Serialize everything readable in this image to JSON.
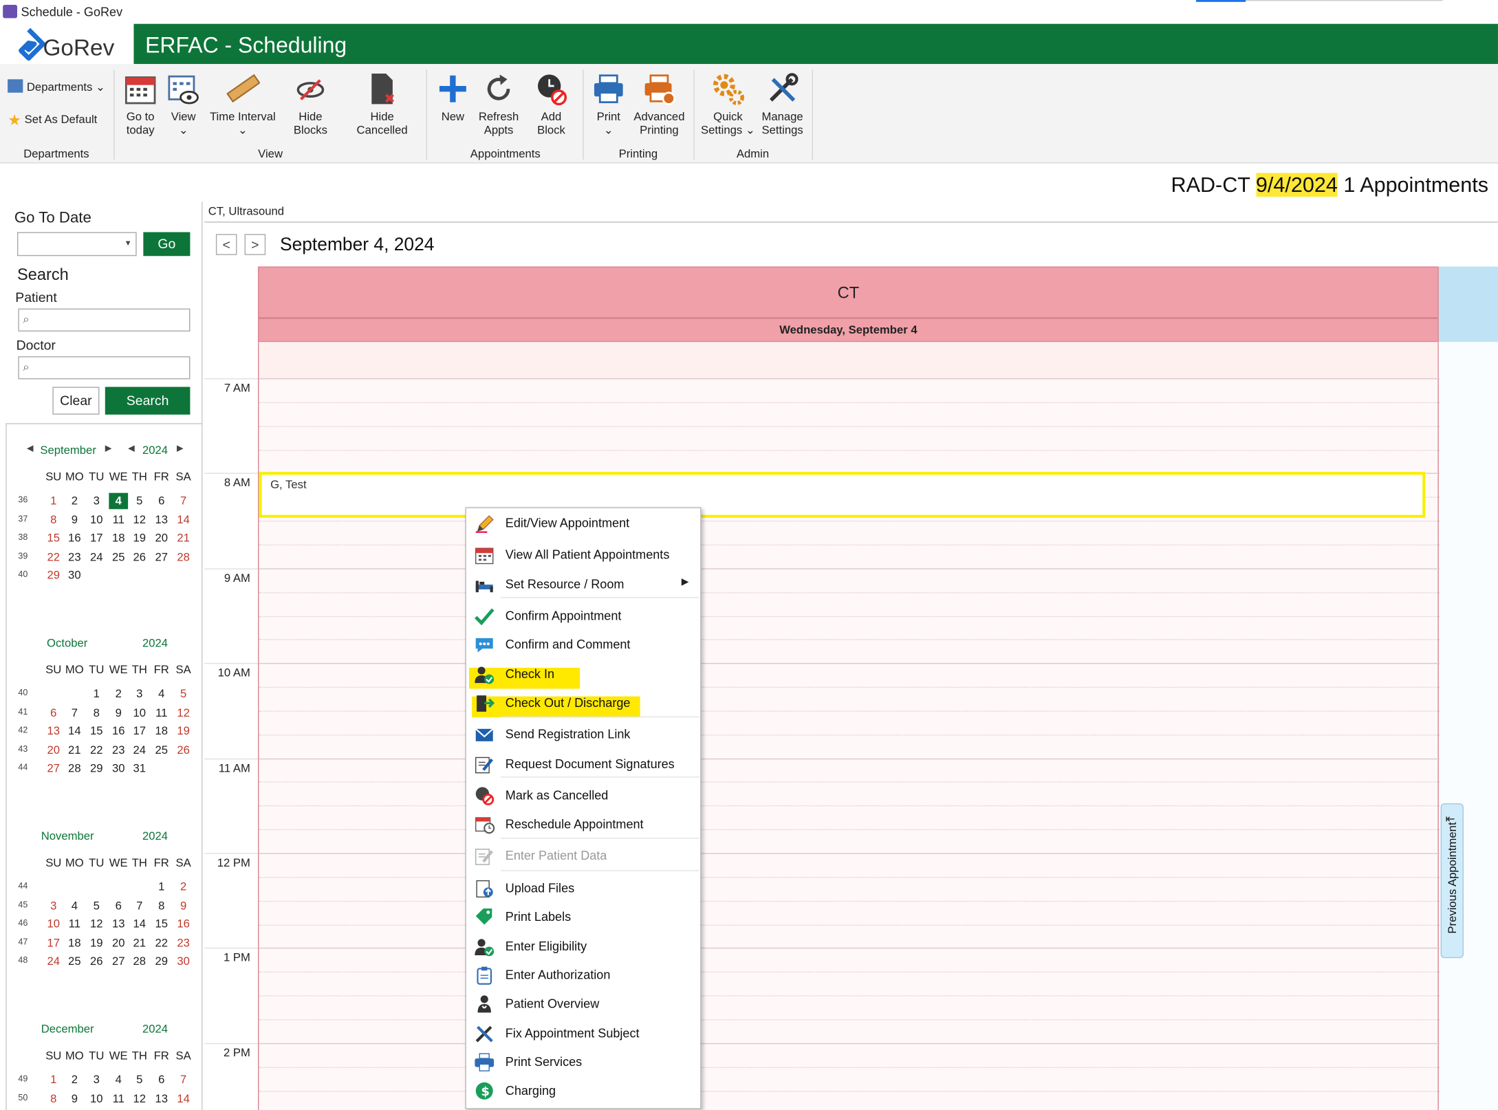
{
  "window": {
    "title": "Schedule - GoRev"
  },
  "header": {
    "logo_text": "GoRev",
    "app_title": "ERFAC - Scheduling",
    "brand_color": "#0d7539"
  },
  "ribbon": {
    "departments": {
      "departments_label": "Departments",
      "set_default_label": "Set As Default",
      "group": "Departments"
    },
    "view": {
      "go_today": [
        "Go to",
        "today"
      ],
      "view": "View",
      "time_interval": "Time Interval",
      "hide_blocks": "Hide Blocks",
      "hide_cancelled": "Hide Cancelled",
      "group": "View"
    },
    "appointments": {
      "new": "New",
      "refresh": [
        "Refresh",
        "Appts"
      ],
      "add_block": "Add Block",
      "group": "Appointments"
    },
    "printing": {
      "print": "Print",
      "advanced": [
        "Advanced",
        "Printing"
      ],
      "group": "Printing"
    },
    "admin": {
      "quick": [
        "Quick",
        "Settings"
      ],
      "manage": [
        "Manage",
        "Settings"
      ],
      "group": "Admin"
    }
  },
  "summary": {
    "dept": "RAD-CT",
    "date": "9/4/2024",
    "count": "1 Appointments",
    "highlight_color": "#ffe835"
  },
  "left": {
    "go_to_date": "Go To Date",
    "go_button": "Go",
    "search_title": "Search",
    "patient_label": "Patient",
    "doctor_label": "Doctor",
    "clear_button": "Clear",
    "search_button": "Search",
    "dow": [
      "SU",
      "MO",
      "TU",
      "WE",
      "TH",
      "FR",
      "SA"
    ],
    "months": [
      {
        "name": "September",
        "year": "2024",
        "nav": true,
        "weeks": [
          {
            "wk": "36",
            "days": [
              "",
              "1",
              "2",
              "3",
              "4",
              "5",
              "6",
              "7"
            ]
          },
          {
            "wk": "37",
            "days": [
              "",
              "8",
              "9",
              "10",
              "11",
              "12",
              "13",
              "14"
            ]
          },
          {
            "wk": "38",
            "days": [
              "",
              "15",
              "16",
              "17",
              "18",
              "19",
              "20",
              "21"
            ]
          },
          {
            "wk": "39",
            "days": [
              "",
              "22",
              "23",
              "24",
              "25",
              "26",
              "27",
              "28"
            ]
          },
          {
            "wk": "40",
            "days": [
              "",
              "29",
              "30",
              "",
              "",
              "",
              "",
              ""
            ]
          }
        ],
        "selected": "4"
      },
      {
        "name": "October",
        "year": "2024",
        "nav": false,
        "weeks": [
          {
            "wk": "40",
            "days": [
              "",
              "",
              "",
              "1",
              "2",
              "3",
              "4",
              "5"
            ]
          },
          {
            "wk": "41",
            "days": [
              "",
              "6",
              "7",
              "8",
              "9",
              "10",
              "11",
              "12"
            ]
          },
          {
            "wk": "42",
            "days": [
              "",
              "13",
              "14",
              "15",
              "16",
              "17",
              "18",
              "19"
            ]
          },
          {
            "wk": "43",
            "days": [
              "",
              "20",
              "21",
              "22",
              "23",
              "24",
              "25",
              "26"
            ]
          },
          {
            "wk": "44",
            "days": [
              "",
              "27",
              "28",
              "29",
              "30",
              "31",
              "",
              ""
            ]
          }
        ]
      },
      {
        "name": "November",
        "year": "2024",
        "nav": false,
        "weeks": [
          {
            "wk": "44",
            "days": [
              "",
              "",
              "",
              "",
              "",
              "",
              "1",
              "2"
            ]
          },
          {
            "wk": "45",
            "days": [
              "",
              "3",
              "4",
              "5",
              "6",
              "7",
              "8",
              "9"
            ]
          },
          {
            "wk": "46",
            "days": [
              "",
              "10",
              "11",
              "12",
              "13",
              "14",
              "15",
              "16"
            ]
          },
          {
            "wk": "47",
            "days": [
              "",
              "17",
              "18",
              "19",
              "20",
              "21",
              "22",
              "23"
            ]
          },
          {
            "wk": "48",
            "days": [
              "",
              "24",
              "25",
              "26",
              "27",
              "28",
              "29",
              "30"
            ]
          }
        ]
      },
      {
        "name": "December",
        "year": "2024",
        "nav": false,
        "weeks": [
          {
            "wk": "49",
            "days": [
              "",
              "1",
              "2",
              "3",
              "4",
              "5",
              "6",
              "7"
            ]
          },
          {
            "wk": "50",
            "days": [
              "",
              "8",
              "9",
              "10",
              "11",
              "12",
              "13",
              "14"
            ]
          }
        ]
      }
    ]
  },
  "schedule": {
    "breadcrumb": "CT, Ultrasound",
    "prev": "<",
    "next": ">",
    "date_heading": "September 4, 2024",
    "resource": "CT",
    "day_header": "Wednesday, September 4",
    "times": [
      "7 AM",
      "8 AM",
      "9 AM",
      "10 AM",
      "11 AM",
      "12 PM",
      "1 PM",
      "2 PM"
    ],
    "appointment": {
      "subject": "G, Test"
    },
    "prev_tab": "Previous Appointment",
    "resource_color": "#f0a0a9"
  },
  "context_menu": {
    "items": [
      {
        "label": "Edit/View Appointment",
        "icon": "pencil-icon"
      },
      {
        "label": "View All Patient Appointments",
        "icon": "calendar-icon"
      },
      {
        "label": "Set Resource / Room",
        "icon": "bed-icon",
        "submenu": true
      },
      {
        "label": "Confirm Appointment",
        "icon": "check-icon"
      },
      {
        "label": "Confirm and Comment",
        "icon": "comment-icon"
      },
      {
        "label": "Check In",
        "icon": "user-check-icon",
        "highlight": true
      },
      {
        "label": "Check Out / Discharge",
        "icon": "exit-icon",
        "highlight": true
      },
      {
        "label": "Send Registration Link",
        "icon": "envelope-icon"
      },
      {
        "label": "Request Document Signatures",
        "icon": "sign-icon"
      },
      {
        "label": "Mark as Cancelled",
        "icon": "cancel-icon"
      },
      {
        "label": "Reschedule Appointment",
        "icon": "reschedule-icon"
      },
      {
        "label": "Enter Patient Data",
        "icon": "edit-doc-icon",
        "disabled": true
      },
      {
        "label": "Upload Files",
        "icon": "upload-icon"
      },
      {
        "label": "Print Labels",
        "icon": "tag-icon"
      },
      {
        "label": "Enter Eligibility",
        "icon": "user-check-icon"
      },
      {
        "label": "Enter Authorization",
        "icon": "clipboard-icon"
      },
      {
        "label": "Patient Overview",
        "icon": "patient-icon"
      },
      {
        "label": "Fix Appointment Subject",
        "icon": "tools-icon"
      },
      {
        "label": "Print Services",
        "icon": "printer-icon"
      },
      {
        "label": "Charging",
        "icon": "dollar-icon"
      }
    ]
  }
}
